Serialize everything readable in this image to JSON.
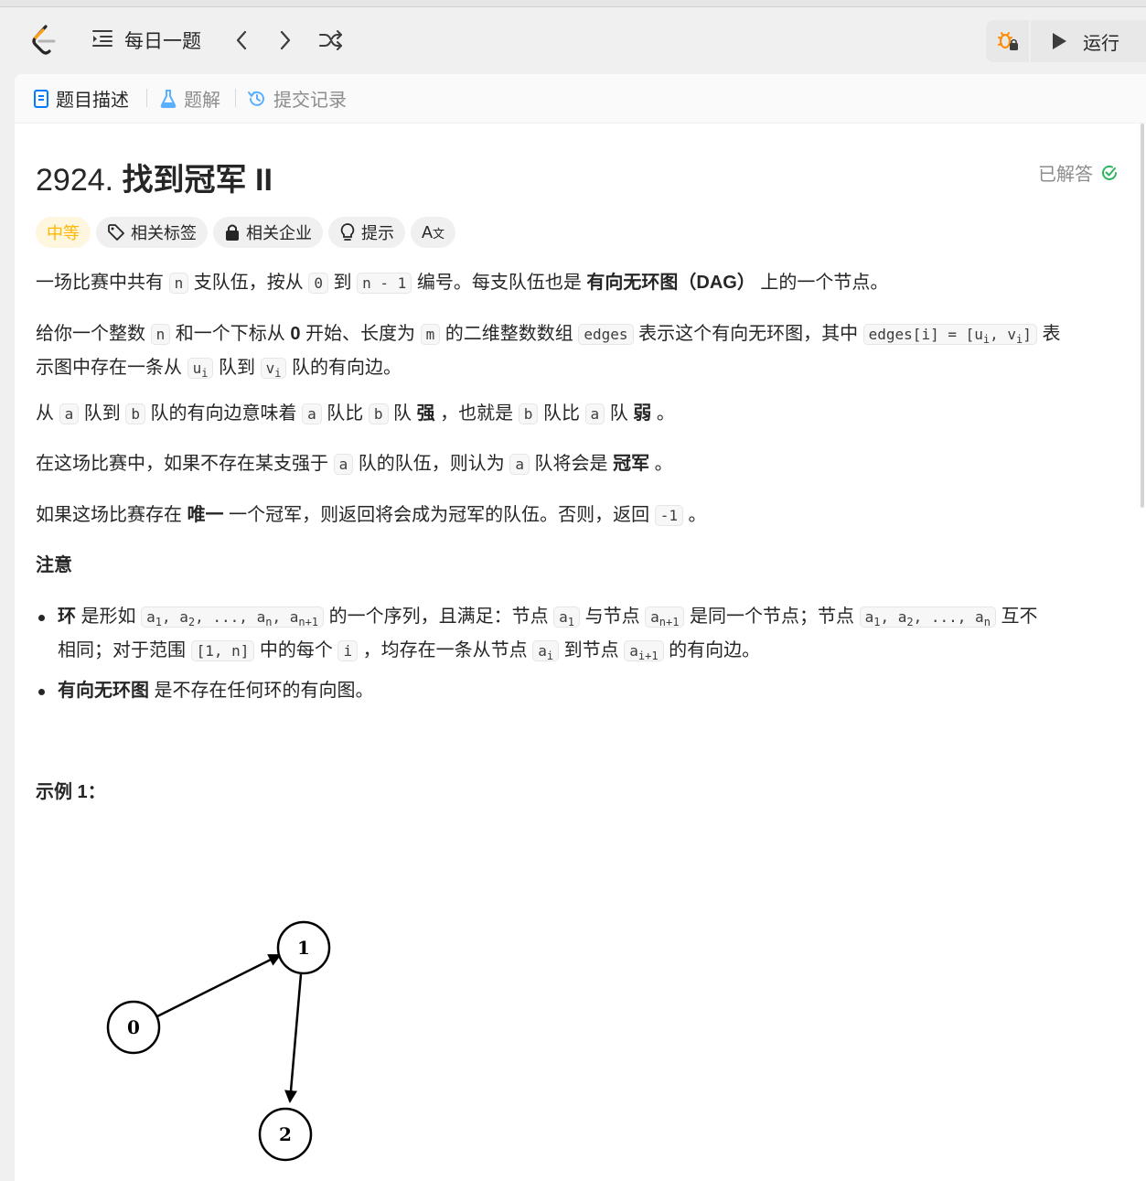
{
  "toolbar": {
    "problem_list_label": "每日一题",
    "run_label": "运行"
  },
  "tabs": [
    {
      "label": "题目描述",
      "active": true
    },
    {
      "label": "题解",
      "active": false
    },
    {
      "label": "提交记录",
      "active": false
    }
  ],
  "problem": {
    "number": "2924.",
    "title": "找到冠军 II",
    "status": "已解答",
    "tags": {
      "difficulty": "中等",
      "related_tags": "相关标签",
      "related_companies": "相关企业",
      "hint": "提示",
      "translate": "A"
    }
  },
  "description": {
    "p1": [
      "一场比赛中共有 ",
      "n",
      " 支队伍，按从 ",
      "0",
      " 到 ",
      "n - 1",
      " 编号。每支队伍也是 ",
      "有向无环图（DAG）",
      " 上的一个节点。"
    ],
    "p2a": [
      "给你一个整数 ",
      "n",
      " 和一个下标从 ",
      "0",
      " 开始、长度为 ",
      "m",
      " 的二维整数数组 ",
      "edges",
      " 表示这个有向无环图，其中 ",
      "edges[i] = [u",
      "i",
      ", v",
      "i",
      "]",
      " 表"
    ],
    "p2b": [
      "示图中存在一条从 ",
      "u",
      "i",
      " 队到 ",
      "v",
      "i",
      " 队的有向边。"
    ],
    "p3": [
      "从 ",
      "a",
      " 队到 ",
      "b",
      " 队的有向边意味着 ",
      "a",
      " 队比 ",
      "b",
      " 队 ",
      "强",
      " ，也就是 ",
      "b",
      " 队比 ",
      "a",
      " 队 ",
      "弱",
      " 。"
    ],
    "p4": [
      "在这场比赛中，如果不存在某支强于 ",
      "a",
      " 队的队伍，则认为 ",
      "a",
      " 队将会是 ",
      "冠军",
      " 。"
    ],
    "p5": [
      "如果这场比赛存在 ",
      "唯一",
      " 一个冠军，则返回将会成为冠军的队伍。否则，返回 ",
      "-1",
      " 。"
    ],
    "note_heading": "注意",
    "bullet1_line1": [
      "环",
      " 是形如 ",
      "a",
      "1",
      ", a",
      "2",
      ", ..., a",
      "n",
      ", a",
      "n+1",
      " 的一个序列，且满足：节点 ",
      "a",
      "1",
      " 与节点 ",
      "a",
      "n+1",
      " 是同一个节点；节点 ",
      "a",
      "1",
      ", a",
      "2",
      ", ..., a",
      "n",
      " 互不"
    ],
    "bullet1_line2": [
      "相同；对于范围 ",
      "[1, n]",
      " 中的每个 ",
      "i",
      " ，均存在一条从节点 ",
      "a",
      "i",
      " 到节点 ",
      "a",
      "i+1",
      " 的有向边。"
    ],
    "bullet2": [
      "有向无环图",
      " 是不存在任何环的有向图。"
    ],
    "example_heading": "示例 1："
  },
  "example_graph": {
    "nodes": [
      "0",
      "1",
      "2"
    ],
    "edges": [
      [
        "0",
        "1"
      ],
      [
        "1",
        "2"
      ]
    ]
  }
}
